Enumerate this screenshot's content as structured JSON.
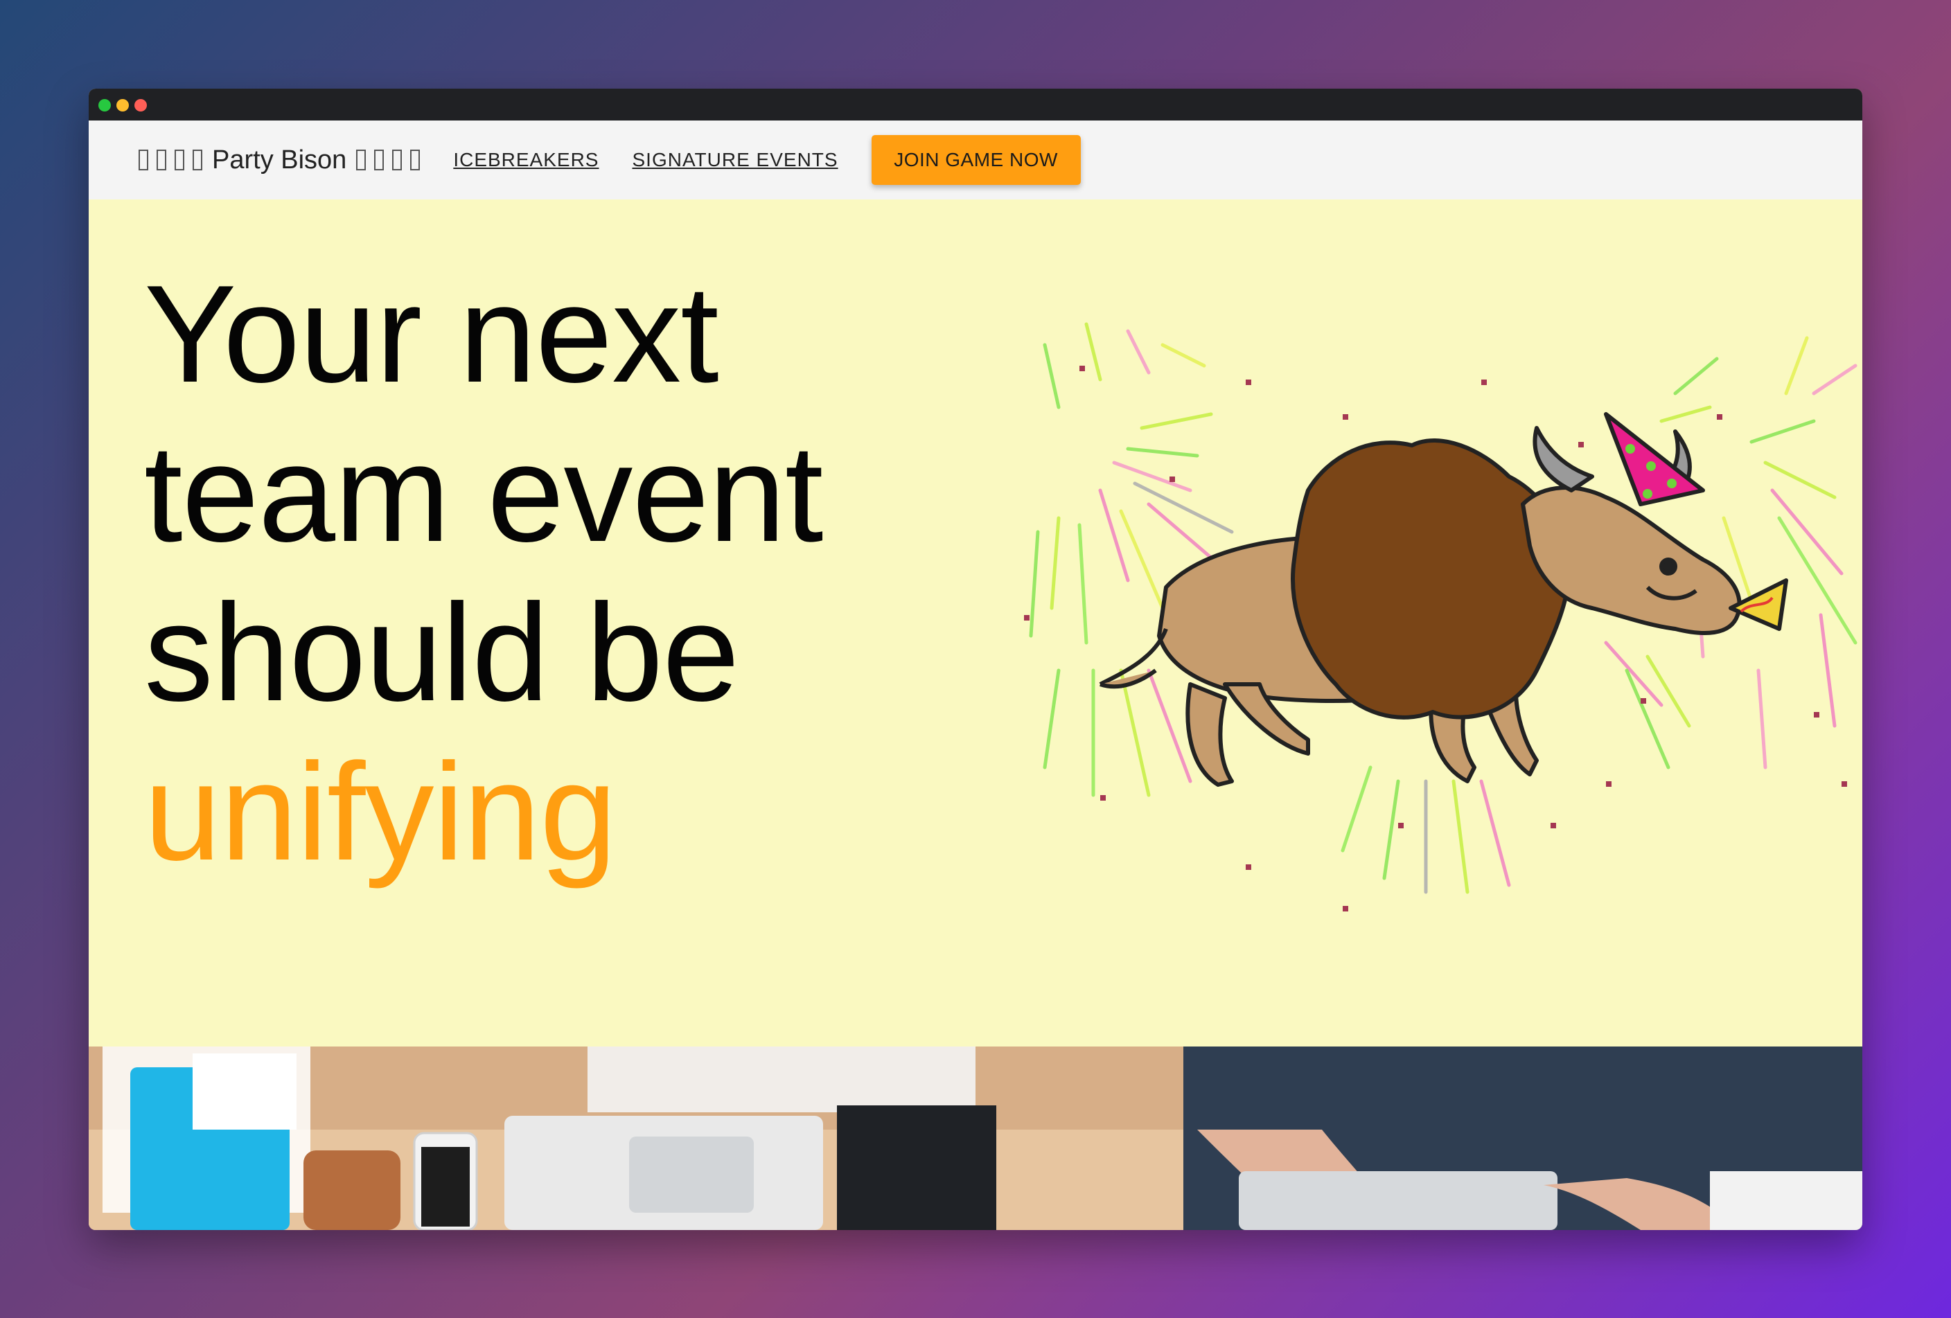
{
  "brand": {
    "name": "Party Bison",
    "left_glyphs": [
      "",
      "",
      "",
      ""
    ],
    "right_glyphs": [
      "",
      "",
      "",
      ""
    ]
  },
  "nav": {
    "links": [
      "ICEBREAKERS",
      "SIGNATURE EVENTS"
    ],
    "cta_label": "JOIN GAME NOW"
  },
  "hero": {
    "lines": [
      "Your next",
      "team event",
      "should be"
    ],
    "highlight": "unifying"
  },
  "colors": {
    "accent": "#ff9e11",
    "hero_background": "#faf9c1",
    "navbar": "#f4f4f4",
    "titlebar": "#202124"
  }
}
